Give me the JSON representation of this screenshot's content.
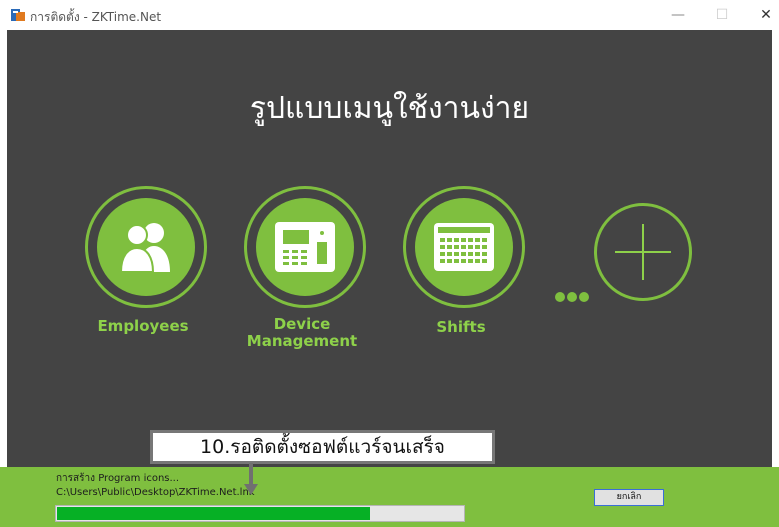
{
  "window": {
    "title": "การติดตั้ง - ZKTime.Net",
    "minimize_glyph": "—",
    "maximize_glyph": "☐",
    "close_glyph": "✕"
  },
  "banner": {
    "headline": "รูปแบบเมนูใช้งานง่าย",
    "items": [
      {
        "label": "Employees",
        "icon": "employees-icon"
      },
      {
        "label": "Device Management",
        "icon": "device-icon"
      },
      {
        "label": "Shifts",
        "icon": "calendar-icon"
      },
      {
        "label": "",
        "icon": "plus-icon"
      }
    ],
    "accent": "#7fbf3f",
    "background": "#444444"
  },
  "installer": {
    "status_line": "การสร้าง Program icons...",
    "path_line": "C:\\Users\\Public\\Desktop\\ZKTime.Net.lnk",
    "progress_fraction": 0.77,
    "cancel_label": "ยกเลิก",
    "bar_color": "#06b025"
  },
  "annotation": {
    "callout_text": "10.รอติดตั้งซอฟต์แวร์จนเสร็จ"
  }
}
